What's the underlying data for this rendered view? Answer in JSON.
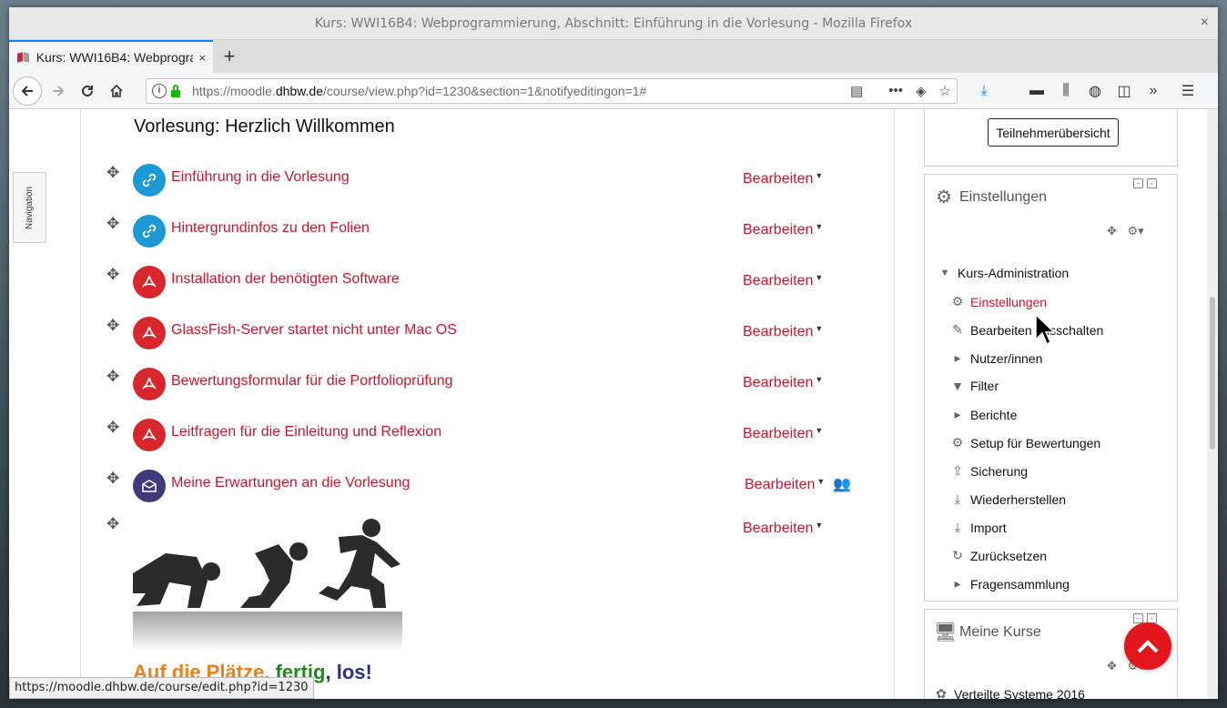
{
  "window": {
    "title": "Kurs: WWI16B4: Webprogrammierung, Abschnitt: Einführung in die Vorlesung - Mozilla Firefox",
    "close": "×"
  },
  "tab": {
    "title": "Kurs: WWI16B4: Webprogrammierung, Abschnitt: Einführung in die Vorlesung",
    "close": "×",
    "new_tab": "+"
  },
  "url": {
    "prefix": "https://moodle.",
    "domain": "dhbw.de",
    "path": "/course/view.php?id=1230&section=1&notifyeditingon=1#"
  },
  "sidebar_tab": {
    "label": "Navigation"
  },
  "section": {
    "title": "Vorlesung: Herzlich Willkommen"
  },
  "edit_label": "Bearbeiten",
  "activities": [
    {
      "name": "Einführung in die Vorlesung",
      "type": "url"
    },
    {
      "name": "Hintergrundinfos zu den Folien",
      "type": "url"
    },
    {
      "name": "Installation der benötigten Software",
      "type": "pdf"
    },
    {
      "name": "GlassFish-Server startet nicht unter Mac OS",
      "type": "pdf"
    },
    {
      "name": "Bewertungsformular für die Portfolioprüfung",
      "type": "pdf"
    },
    {
      "name": "Leitfragen für die Einleitung und Reflexion",
      "type": "pdf"
    },
    {
      "name": "Meine Erwartungen an die Vorlesung",
      "type": "assign"
    }
  ],
  "slogan": {
    "part1": "Auf die Plätze, ",
    "part2": "fertig",
    "part3": ", los!"
  },
  "status_url": "https://moodle.dhbw.de/course/edit.php?id=1230",
  "participants_button": "Teilnehmerübersicht",
  "settings_block": {
    "title": "Einstellungen",
    "root": "Kurs-Administration",
    "items": [
      {
        "label": "Einstellungen",
        "icon": "gear-icon",
        "active": true
      },
      {
        "label": "Bearbeiten ausschalten",
        "icon": "pencil-icon",
        "active": false
      },
      {
        "label": "Nutzer/innen",
        "icon": "expand-arrow-icon",
        "active": false
      },
      {
        "label": "Filter",
        "icon": "filter-icon",
        "active": false
      },
      {
        "label": "Berichte",
        "icon": "expand-arrow-icon",
        "active": false
      },
      {
        "label": "Setup für Bewertungen",
        "icon": "gear-icon",
        "active": false
      },
      {
        "label": "Sicherung",
        "icon": "upload-icon",
        "active": false
      },
      {
        "label": "Wiederherstellen",
        "icon": "download-icon",
        "active": false
      },
      {
        "label": "Import",
        "icon": "download-icon",
        "active": false
      },
      {
        "label": "Zurücksetzen",
        "icon": "reset-icon",
        "active": false
      },
      {
        "label": "Fragensammlung",
        "icon": "expand-arrow-icon",
        "active": false
      }
    ]
  },
  "courses_block": {
    "title": "Meine Kurse",
    "items": [
      "Verteilte Systeme 2016"
    ]
  },
  "colors": {
    "link_red": "#d0132b",
    "url_blue": "#1c9ad6",
    "pdf_red": "#d9262c",
    "assign_purple": "#3f3a7a",
    "fab_red": "#e3161b"
  }
}
